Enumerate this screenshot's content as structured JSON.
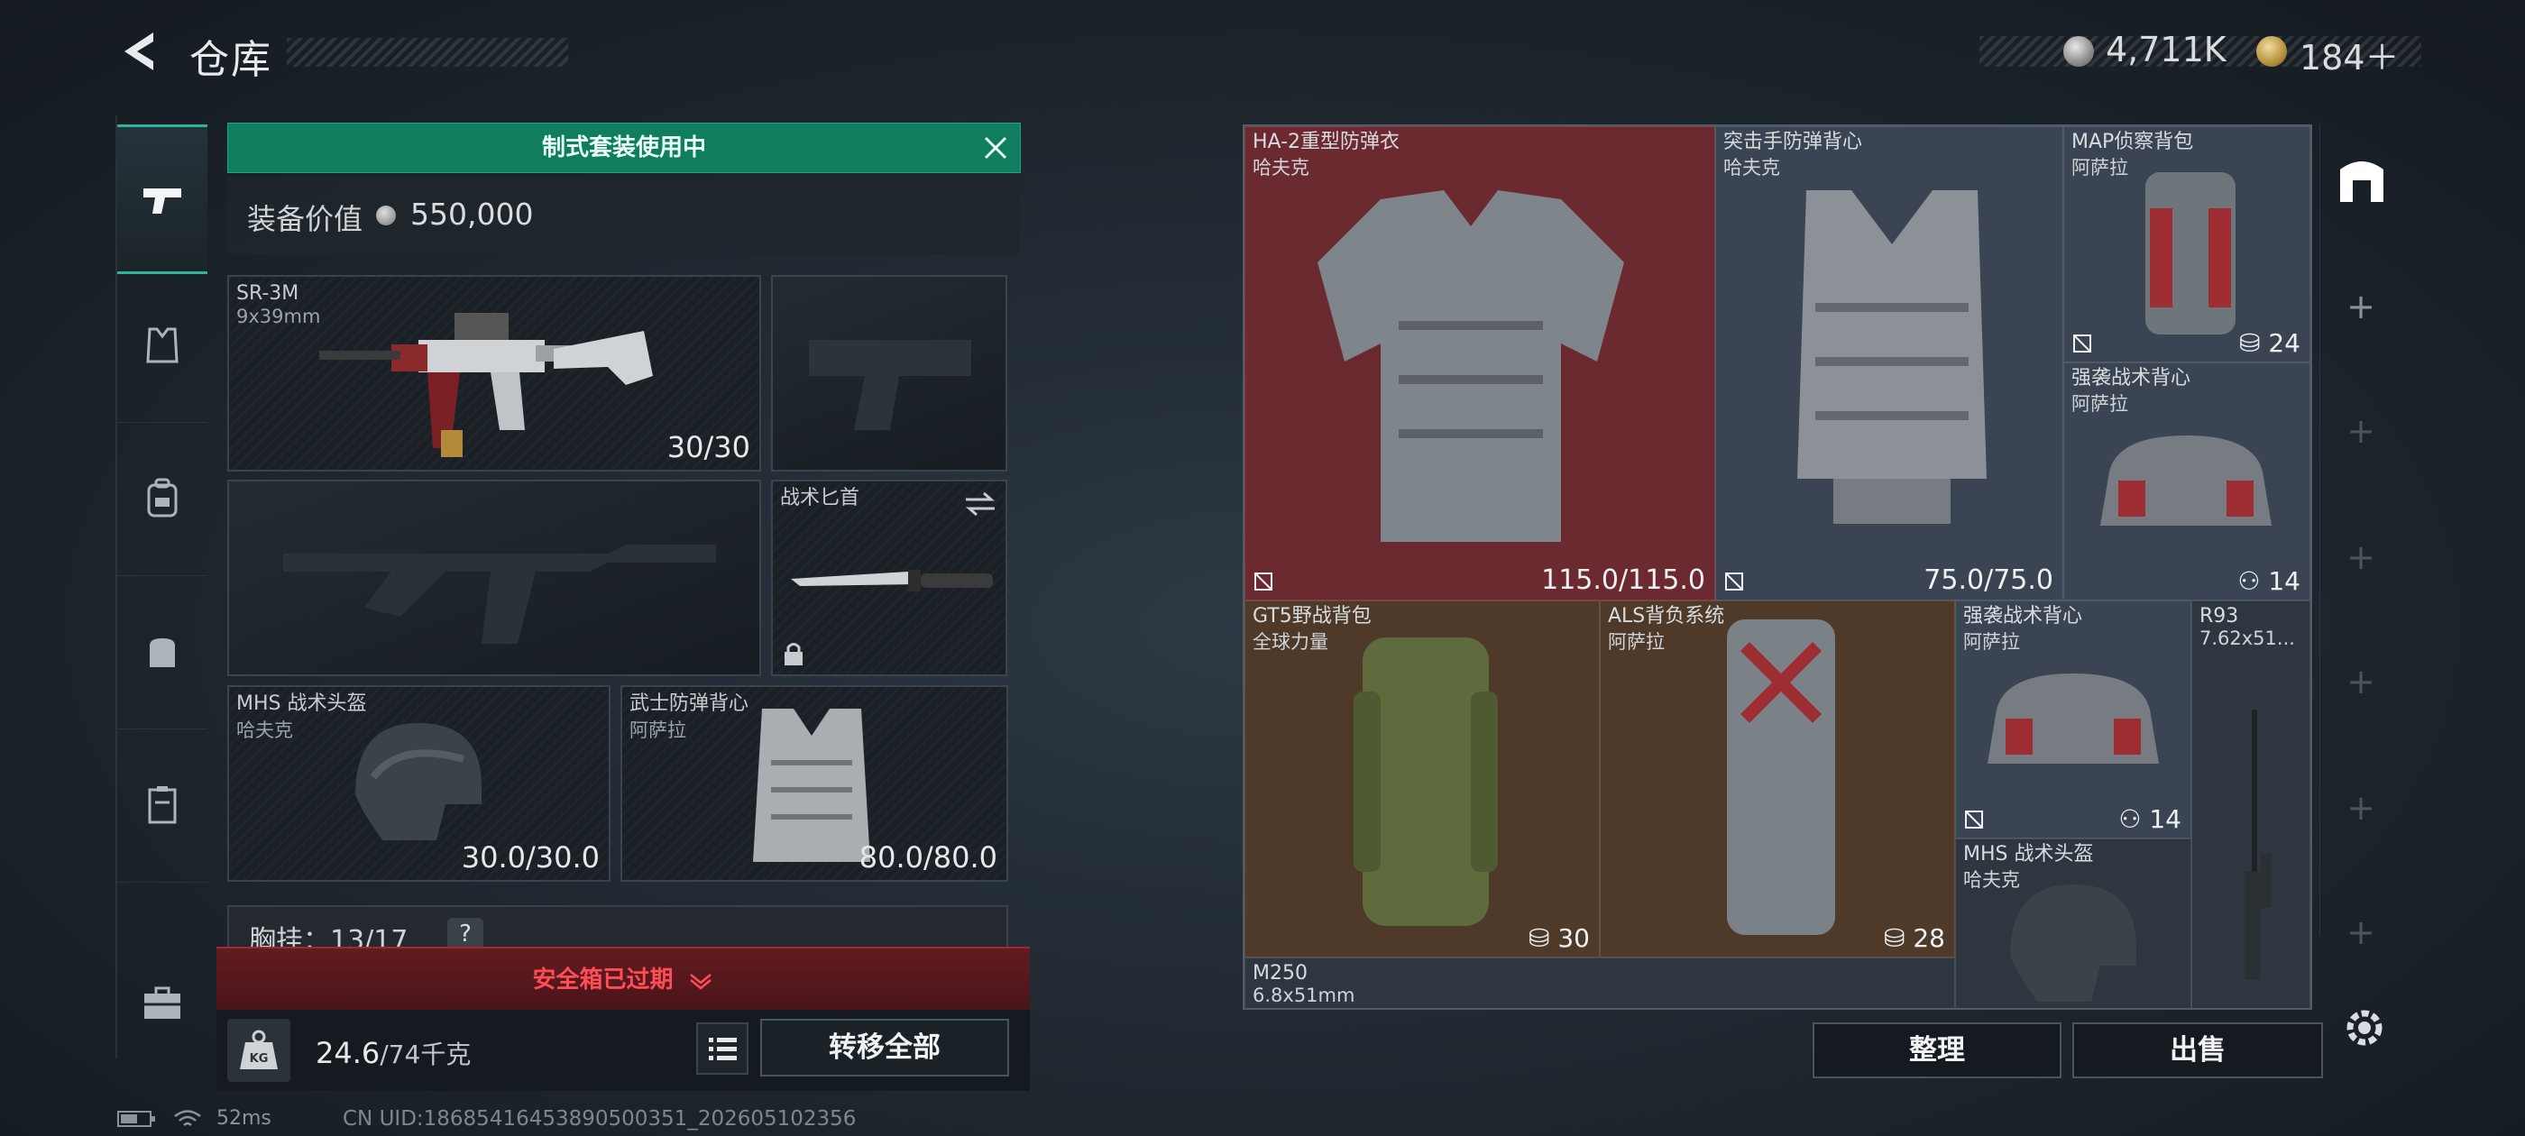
{
  "header": {
    "title": "仓库",
    "currency_silver": "4,711K",
    "currency_gold": "184＋"
  },
  "loadout": {
    "banner": "制式套装使用中",
    "value_label": "装备价值",
    "value": "550,000",
    "slots": [
      {
        "name": "SR-3M",
        "sub": "9x39mm",
        "durability": "30/30"
      },
      {
        "name": "战术匕首"
      },
      {
        "name": "MHS 战术头盔",
        "sub": "哈夫克",
        "durability": "30.0/30.0"
      },
      {
        "name": "武士防弹背心",
        "sub": "阿萨拉",
        "durability": "80.0/80.0"
      }
    ],
    "chest_label": "胸挂：13/17",
    "chest_help": "?",
    "alert": "安全箱已过期",
    "weight": "24.6",
    "weight_unit": "/74千克",
    "transfer_label": "转移全部"
  },
  "storage": {
    "items": [
      {
        "name": "HA-2重型防弹衣",
        "sub": "哈夫克",
        "durability": "115.0/115.0"
      },
      {
        "name": "突击手防弹背心",
        "sub": "哈夫克",
        "durability": "75.0/75.0"
      },
      {
        "name": "MAP侦察背包",
        "sub": "阿萨拉",
        "capacity": "24"
      },
      {
        "name": "强袭战术背心",
        "sub": "阿萨拉",
        "capacity": "14"
      },
      {
        "name": "GT5野战背包",
        "sub": "全球力量",
        "capacity": "30"
      },
      {
        "name": "ALS背负系统",
        "sub": "阿萨拉",
        "capacity": "28"
      },
      {
        "name": "强袭战术背心",
        "sub": "阿萨拉",
        "capacity": "14"
      },
      {
        "name": "R93",
        "sub": "7.62x51..."
      },
      {
        "name": "MHS 战术头盔",
        "sub": "哈夫克"
      },
      {
        "name": "M250",
        "sub": "6.8x51mm"
      }
    ],
    "sort_label": "整理",
    "sell_label": "出售"
  },
  "status": {
    "ping": "52ms",
    "uid": "CN UID:18685416453890500351_202605102356"
  },
  "colors": {
    "accent": "#0f7d5e",
    "alert": "#ff4d55",
    "armor_bg": "#6b2a30",
    "backpack_bg": "#4f3a2a"
  }
}
